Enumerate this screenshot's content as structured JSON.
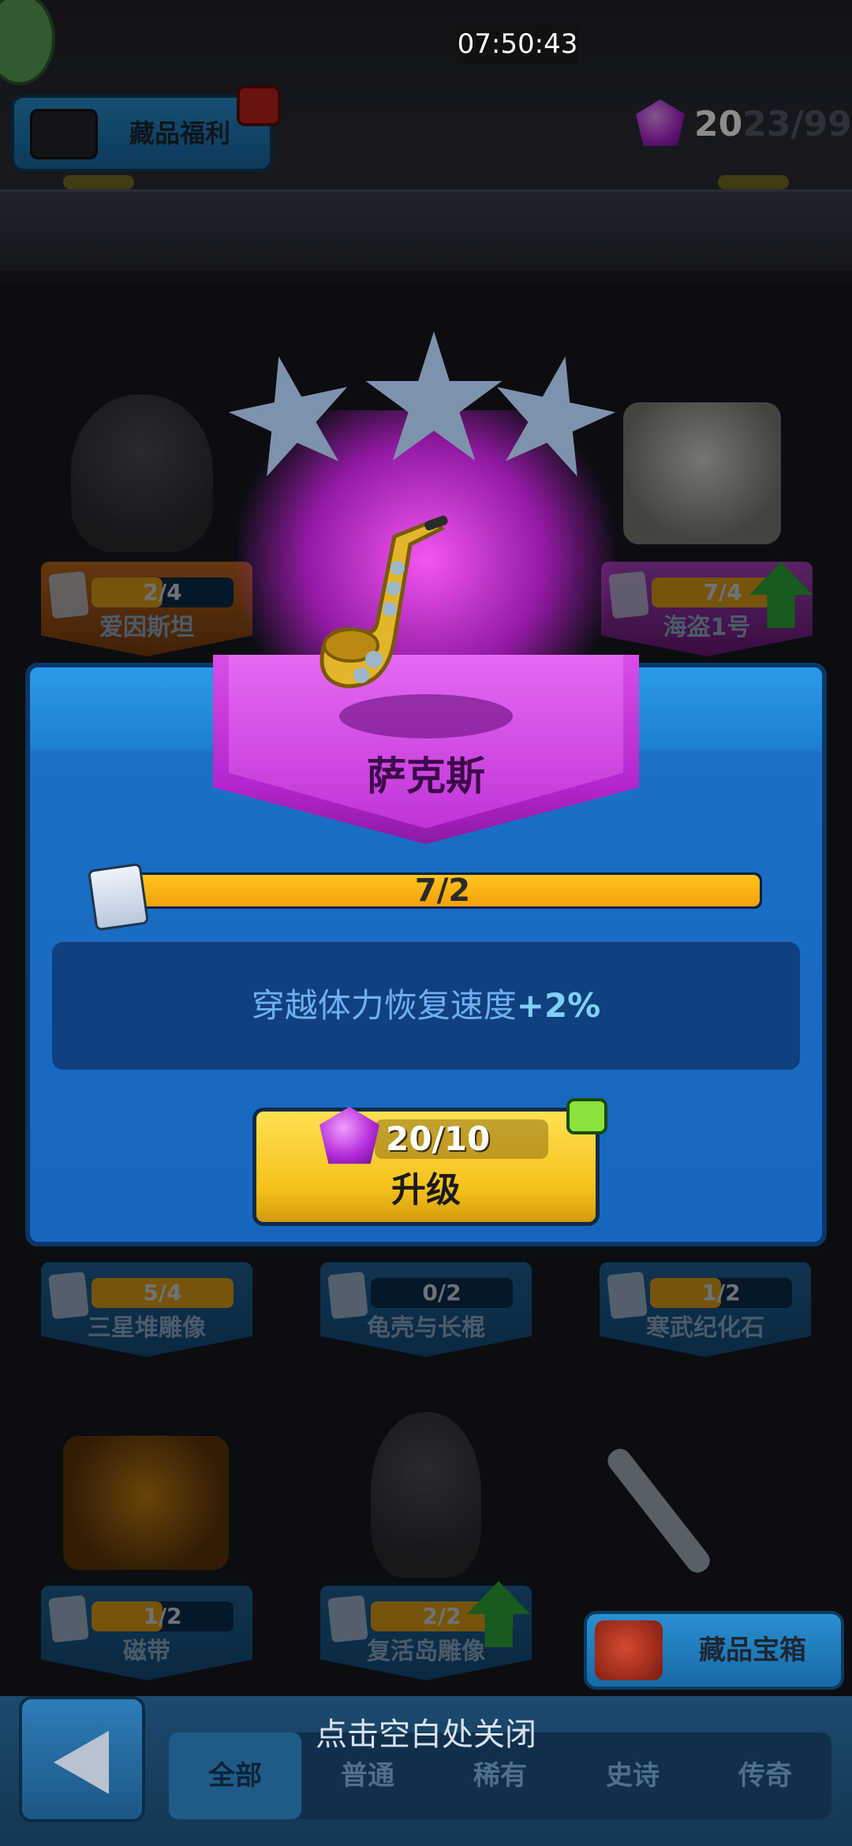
{
  "status": {
    "clock": "07:50:43"
  },
  "header": {
    "collection_benefit_label": "藏品福利",
    "gems": {
      "current": "20",
      "rest": "23/99"
    }
  },
  "background_cards": [
    {
      "name": "爱因斯坦",
      "ratio": "2/4",
      "progress": 0.5,
      "rarity": "gold"
    },
    {
      "name": "海盗1号",
      "ratio": "7/4",
      "progress": 1.0,
      "rarity": "purple",
      "upgradable": true
    },
    {
      "name": "三星堆雕像",
      "ratio": "5/4",
      "progress": 1.0,
      "rarity": "blue"
    },
    {
      "name": "龟壳与长棍",
      "ratio": "0/2",
      "progress": 0.0,
      "rarity": "blue"
    },
    {
      "name": "寒武纪化石",
      "ratio": "1/2",
      "progress": 0.5,
      "rarity": "blue"
    },
    {
      "name": "磁带",
      "ratio": "1/2",
      "progress": 0.5,
      "rarity": "blue"
    },
    {
      "name": "复活岛雕像",
      "ratio": "2/2",
      "progress": 1.0,
      "rarity": "blue",
      "upgradable": true
    }
  ],
  "popup": {
    "item_name": "萨克斯",
    "stars": 3,
    "progress_text": "7/2",
    "progress": 1.0,
    "effect_text": "穿越体力恢复速度",
    "effect_bonus": "+2%",
    "upgrade_cost": "20/10",
    "upgrade_label": "升级"
  },
  "footer": {
    "close_hint": "点击空白处关闭",
    "chest_label": "藏品宝箱",
    "tabs": [
      {
        "label": "全部",
        "active": true
      },
      {
        "label": "普通"
      },
      {
        "label": "稀有"
      },
      {
        "label": "史诗"
      },
      {
        "label": "传奇"
      }
    ]
  },
  "colors": {
    "popup_blue": "#1865be",
    "banner_purple": "#c133d8",
    "progress_orange": "#f4a00a",
    "button_yellow": "#f5c11a",
    "gem_purple": "#b12ad8"
  }
}
